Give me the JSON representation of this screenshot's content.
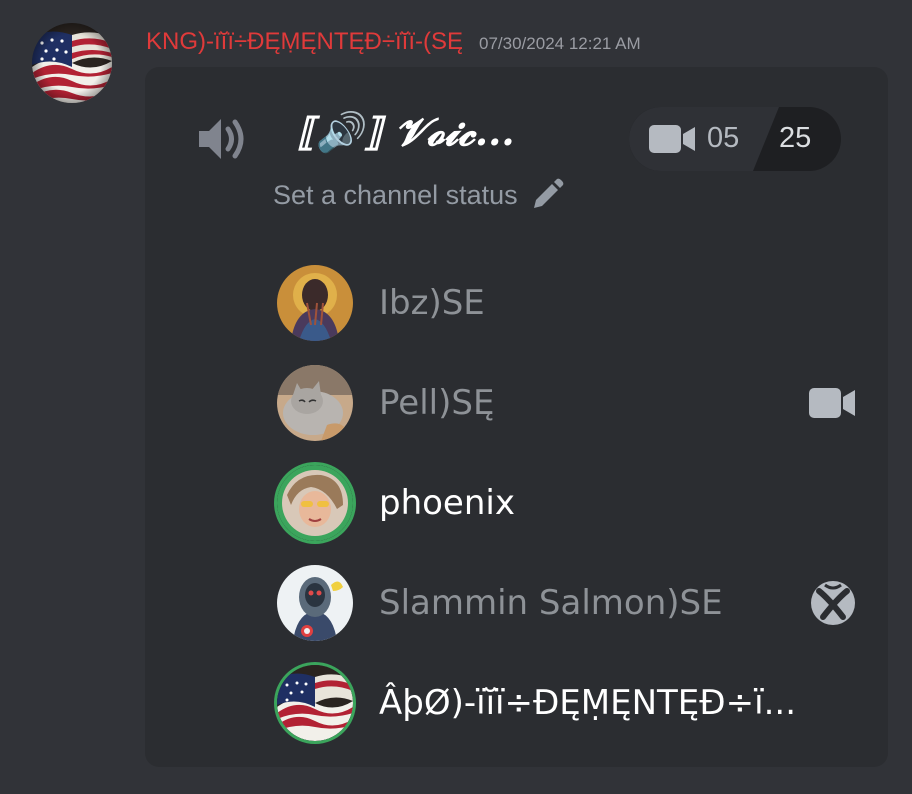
{
  "message": {
    "author_name": "KNG)-ïĭï÷ĐĘṂĘNTĘĐ÷ïĭï-(SĘ",
    "timestamp": "07/30/2024 12:21 AM"
  },
  "voice_card": {
    "channel_name": "⟦🔊⟧ 𝓥𝓸𝓲𝓬...",
    "user_count": "05",
    "user_limit": "25",
    "status_prompt": "Set a channel status"
  },
  "members": [
    {
      "name": "Ibz)SE",
      "state": "idle",
      "trailing_icon": ""
    },
    {
      "name": "Pell)SĘ",
      "state": "idle",
      "trailing_icon": "video-camera-icon"
    },
    {
      "name": "phoenix",
      "state": "speaking",
      "trailing_icon": ""
    },
    {
      "name": "Slammin Salmon)SE",
      "state": "idle",
      "trailing_icon": "xbox-icon"
    },
    {
      "name": "ÂþØ)-ïĭï÷ĐĘṂĘNTĘĐ÷ï...",
      "state": "speaking",
      "trailing_icon": ""
    }
  ],
  "colors": {
    "author": "#e03a3a",
    "speaking_ring": "#3ba55c",
    "card_bg": "#2b2d31",
    "page_bg": "#313338"
  }
}
